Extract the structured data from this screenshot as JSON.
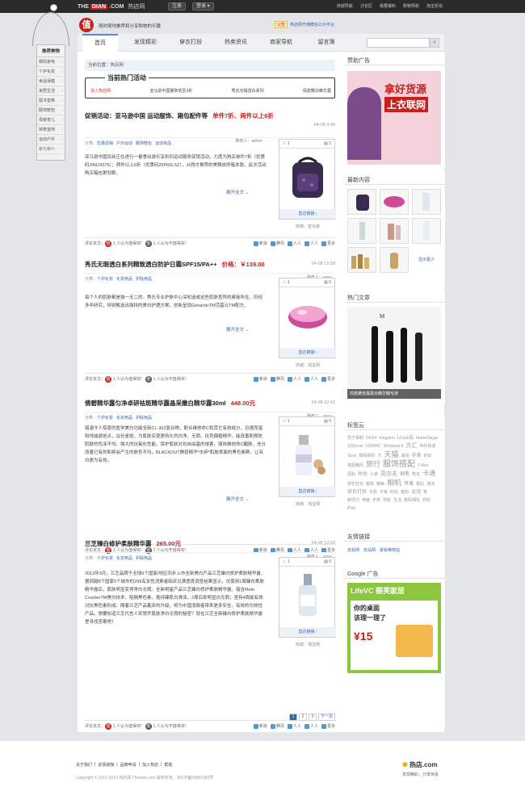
{
  "topbar": {
    "logo_left": "THE",
    "logo_box": "DIAN",
    "logo_right": ".COM",
    "logo_cn": "热店网",
    "register": "注册",
    "login": "登录",
    "links": [
      "商城导航",
      "讨论区",
      "我要爆料",
      "购物导航",
      "淘宝折扣"
    ]
  },
  "header": {
    "logo_char": "值",
    "slogan": "随时随地推荐和分享购物的乐趣",
    "notice_tag": "公告",
    "notice_text": "热店网开通微信公众平台"
  },
  "leftnav": {
    "title": "推荐美物",
    "items": [
      "数码家电",
      "个护化妆",
      "食品保健",
      "家居生活",
      "图书音像",
      "服饰鞋包",
      "母婴育儿",
      "钟表首饰",
      "运动户外",
      "杂七杂八"
    ]
  },
  "nav": {
    "items": [
      "首页",
      "发现精彩",
      "穿衣打扮",
      "热卖资讯",
      "商家导航",
      "留言簿"
    ]
  },
  "breadcrumb": "当前位置：热店网",
  "hot": {
    "title": "当前热门活动",
    "items": [
      "加入热店网",
      "亚马逊中国服饰低至3折",
      "秀氏无瑕透白系列",
      "倩碧鞭白精华露"
    ]
  },
  "posts": [
    {
      "title": "促销活动：亚马逊中国 运动服饰、箱包配件等",
      "price": "单件7折、两件以上6折",
      "date": "04-08 3:45",
      "cats": [
        "分类：",
        "优惠促销",
        "户外运动",
        "服饰鞋包",
        "运动用品"
      ],
      "rec": "推荐人：admin",
      "body": "亚马逊中国目前正在进行一春季出游乐享折扣运动服务促销活动，力度为购买单件7折（优惠码JINUX075）；两件以上6折（优惠码25P65LSZ），从刚才推荐的美猴皮肝箱本款，此次活动购买箱包更划算。",
      "more": "展开全文",
      "likes": "1",
      "comments": "0",
      "link": "直达链接",
      "shop": "商城：亚马逊",
      "yes": "1 人认为值得买!",
      "no": "1 人认为不值得买!"
    },
    {
      "title": "秀氏无瑕透白系列精致透白防护日霜SPF15/PA++",
      "price": "价格：￥139.00",
      "date": "04-08 12:58",
      "cats": [
        "分类：",
        "个护化妆",
        "化妆用品",
        "护肤用品"
      ],
      "rec": "推荐人：anna",
      "body": "每个人的肌肤都是独一无二的。秀氏专业护肤中心深知追或这些肌肤差异的奥秘所在。历经多年研究，特别甄选出独特的美白护理方案，创新呈现GenactivTM活基元TM配方。",
      "more": "展开全文",
      "likes": "1",
      "comments": "0",
      "link": "直达链接",
      "shop": "商城：淘宝网",
      "yes": "1 人认为值得买!",
      "no": "1 人认为不值得买!"
    },
    {
      "title": "倩碧精华露匀净卓研祛斑精华露晶采嫩白精华露30ml",
      "price": "448.00元",
      "date": "04-08 12:42",
      "cats": [
        "分类：",
        "个护化妆",
        "化妆用品",
        "护肤用品"
      ],
      "rec": "推荐人：anna",
      "body": "蕴涵令人惊喜的医学美白功能全新CL-302复合物，配合维他命C和其它有效成分，迅速而温和地减退斑点，淡化雀斑，为肌肤实现更持久的白净、无瑕。抗壳偶植精华，能改善和预防肌肤的色泽不均。强大的抗氧化性能，保护肌肤对抗自由基的侵害，强效维他命C醒肤，充分改善已有的和将会产生的肤色不均。BLACKOUT静寂精华*击碎*肌肤表面的黑色素群，让亮白更为有效。",
      "more": "展开全文",
      "likes": "1",
      "comments": "0",
      "link": "直达链接",
      "shop": "商城：淘宝网",
      "yes": "1 人认为值得买!",
      "no": "1 人认为不值得买!"
    },
    {
      "title": "兰芝臻白修护柔肤精华露",
      "price": "265.00元",
      "date": "04-08 12:29",
      "cats": [
        "分类：",
        "个护化妆",
        "化妆用品",
        "护肤用品"
      ],
      "rec": "推荐人：anna",
      "body": "2013年3月，兰芝品牌于全球9个国家/地区同步上市全新美白产品兰芝臻白修护柔肤精华露，据调越8个国家5个城市的299名女性消费者临床见满意度调查结果显示，仅使用1周臻白柔肤精华露后，肌肤明显变得净白无暇。全新明星产品兰芝臻白修护柔肤精华露，蕴含Melo CrusherTM美白技术，阻隔黑色素，抱持臻肌白滑泽。2周后即明显白无瑕；坚持4周能有效对抗黑色素形成。随着兰芝产品着床的升级，将为中国消费者带来更多安全、有效的功效性产品。想要知道兰芝代言人宋慧乔肌肤净白无瑕的秘密？就在兰芝全新臻白修护柔肤精华露里寻找答案吧！",
      "more": "",
      "likes": "1",
      "comments": "0",
      "link": "直达链接",
      "shop": "商城：淘宝网",
      "yes": "1 人认为值得买!",
      "no": "1 人认为不值得买!"
    }
  ],
  "shares": [
    "新浪",
    "腾讯",
    "人人",
    "人人",
    "更多"
  ],
  "comment_label": "评论本文：",
  "pager": [
    "1",
    "2",
    "3",
    "下一页"
  ],
  "side": {
    "ad_title": "赞助广告",
    "ad_line1": "拿好货源",
    "ad_line2": "上衣联网",
    "latest_title": "最新内容",
    "latest_more": "显示更少",
    "hot_title": "热门文章",
    "hot_caption": "玛丽黛佳漏发出精华睫毛液",
    "tags_title": "标签云",
    "tags": [
      "苏宁易购",
      "DRS4",
      "Kingston",
      "Linux云",
      "MarleDalgar",
      "SSDnow",
      "V300MC",
      "Windows 8",
      "方汇",
      "世外桃源",
      "Xbox",
      "数码相机",
      "方",
      "天猫",
      "海淘",
      "手表",
      "折扣",
      "搭配韩风",
      "旅行",
      "服饰搭配",
      "T-Rex",
      "团购",
      "时尚",
      "小游",
      "高尔夫",
      "钢笔",
      "秀氏",
      "卡通",
      "穿衣打扮",
      "服饰",
      "精美",
      "相机",
      "苹果",
      "数码",
      "潮流",
      "穿衣打扮",
      "手机",
      "平板",
      "时尚",
      "箱包",
      "运动",
      "鞋",
      "剃须刀",
      "电脑",
      "手表",
      "导航",
      "生活",
      "数码相机",
      "奶粉",
      "iPad"
    ],
    "links_title": "友情链接",
    "links": [
      "去处网",
      "名站网",
      "豪锐维修站"
    ],
    "google_title": "Google 广告",
    "google_brand": "LifeVC 丽芙家居",
    "google_sub": "你的桌面",
    "google_sub2": "该理一理了",
    "google_price": "¥15"
  },
  "footer": {
    "links": [
      "关于我们",
      "友情链接",
      "品牌申请",
      "加入热店",
      "帮助"
    ],
    "copyright": "Copyright © 2012-2013 热店网 Thedian.com 版权所有，京ICP备09001682号",
    "logo": "热店.com",
    "logo_sub": "发现精彩，分享惊喜"
  },
  "colors": {
    "brand": "#c8201f",
    "link": "#3366aa"
  }
}
